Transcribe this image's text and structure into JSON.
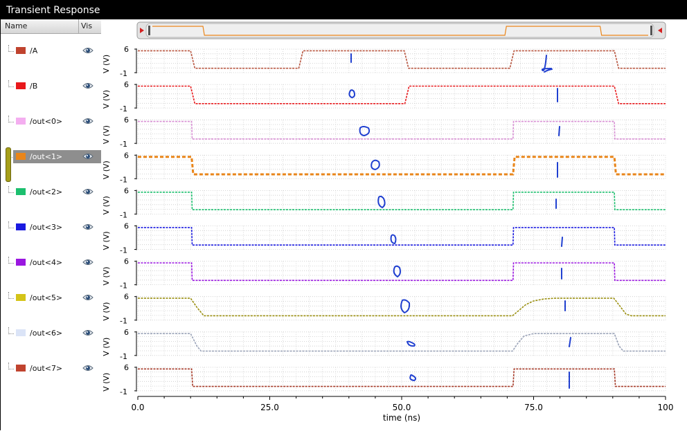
{
  "window": {
    "title": "Transient Response"
  },
  "columns": {
    "name": "Name",
    "vis": "Vis"
  },
  "signals": [
    {
      "label": "/A",
      "color": "#c0432e",
      "selected": false
    },
    {
      "label": "/B",
      "color": "#e8181b",
      "selected": false
    },
    {
      "label": "/out<0>",
      "color": "#f4aef0",
      "selected": false
    },
    {
      "label": "/out<1>",
      "color": "#e98519",
      "selected": true
    },
    {
      "label": "/out<2>",
      "color": "#1cbf6e",
      "selected": false
    },
    {
      "label": "/out<3>",
      "color": "#1a1ae0",
      "selected": false
    },
    {
      "label": "/out<4>",
      "color": "#9a17e0",
      "selected": false
    },
    {
      "label": "/out<5>",
      "color": "#d4c418",
      "selected": false
    },
    {
      "label": "/out<6>",
      "color": "#dbe4f7",
      "selected": false
    },
    {
      "label": "/out<7>",
      "color": "#c0432e",
      "selected": false
    }
  ],
  "chart_data": {
    "type": "line",
    "xlabel": "time (ns)",
    "x_ticks": [
      "0.0",
      "25.0",
      "50.0",
      "75.0",
      "100"
    ],
    "x_range": [
      0,
      100
    ],
    "y_label_each": "V (V)",
    "y_ticks": [
      "6",
      "-1"
    ],
    "y_range": [
      -1,
      6
    ],
    "grid": true,
    "series": [
      {
        "name": "/A",
        "color": "#b8553f",
        "points": [
          [
            0,
            5.5
          ],
          [
            10,
            5.5
          ],
          [
            10.8,
            0.3
          ],
          [
            30.5,
            0.3
          ],
          [
            31.3,
            5.5
          ],
          [
            50.5,
            5.5
          ],
          [
            51.3,
            0.3
          ],
          [
            70.5,
            0.3
          ],
          [
            71.3,
            5.5
          ],
          [
            90.3,
            5.5
          ],
          [
            91.1,
            0.3
          ],
          [
            100,
            0.3
          ]
        ]
      },
      {
        "name": "/B",
        "color": "#e8181b",
        "points": [
          [
            0,
            5.5
          ],
          [
            10,
            5.5
          ],
          [
            10.8,
            0.3
          ],
          [
            50.6,
            0.3
          ],
          [
            51.4,
            5.5
          ],
          [
            90.3,
            5.5
          ],
          [
            91.1,
            0.3
          ],
          [
            100,
            0.3
          ]
        ]
      },
      {
        "name": "/out<0>",
        "color": "#d88fd4",
        "points": [
          [
            0,
            5.5
          ],
          [
            10.2,
            5.5
          ],
          [
            10.3,
            0.3
          ],
          [
            71.1,
            0.3
          ],
          [
            71.2,
            5.5
          ],
          [
            90.3,
            5.5
          ],
          [
            90.4,
            0.3
          ],
          [
            100,
            0.3
          ]
        ]
      },
      {
        "name": "/out<1>",
        "color": "#e98519",
        "points": [
          [
            0,
            5.5
          ],
          [
            10.2,
            5.5
          ],
          [
            10.5,
            0.3
          ],
          [
            71.1,
            0.3
          ],
          [
            71.4,
            5.5
          ],
          [
            90.3,
            5.5
          ],
          [
            90.6,
            0.3
          ],
          [
            100,
            0.3
          ]
        ]
      },
      {
        "name": "/out<2>",
        "color": "#1cbf6e",
        "points": [
          [
            0,
            5.5
          ],
          [
            10.2,
            5.5
          ],
          [
            10.3,
            0.3
          ],
          [
            71.1,
            0.3
          ],
          [
            71.2,
            5.5
          ],
          [
            90.3,
            5.5
          ],
          [
            90.4,
            0.3
          ],
          [
            100,
            0.3
          ]
        ]
      },
      {
        "name": "/out<3>",
        "color": "#1a1ae0",
        "points": [
          [
            0,
            5.5
          ],
          [
            10.2,
            5.5
          ],
          [
            10.3,
            0.3
          ],
          [
            71.1,
            0.3
          ],
          [
            71.2,
            5.5
          ],
          [
            90.3,
            5.5
          ],
          [
            90.4,
            0.3
          ],
          [
            100,
            0.3
          ]
        ]
      },
      {
        "name": "/out<4>",
        "color": "#9a17e0",
        "points": [
          [
            0,
            5.5
          ],
          [
            10.2,
            5.5
          ],
          [
            10.3,
            0.3
          ],
          [
            71.1,
            0.3
          ],
          [
            71.2,
            5.5
          ],
          [
            90.3,
            5.5
          ],
          [
            90.4,
            0.3
          ],
          [
            100,
            0.3
          ]
        ]
      },
      {
        "name": "/out<5>",
        "color": "#9a8f10",
        "points": [
          [
            0,
            5.5
          ],
          [
            10,
            5.5
          ],
          [
            11.2,
            2.8
          ],
          [
            12.5,
            0.3
          ],
          [
            71,
            0.3
          ],
          [
            72,
            1.6
          ],
          [
            73.5,
            3.6
          ],
          [
            75,
            4.7
          ],
          [
            77,
            5.3
          ],
          [
            79,
            5.5
          ],
          [
            90.2,
            5.5
          ],
          [
            91.2,
            3.5
          ],
          [
            92.5,
            0.8
          ],
          [
            93.5,
            0.3
          ],
          [
            100,
            0.3
          ]
        ]
      },
      {
        "name": "/out<6>",
        "color": "#9aa3b8",
        "points": [
          [
            0,
            5.5
          ],
          [
            10,
            5.5
          ],
          [
            11.2,
            1.8
          ],
          [
            12,
            0.3
          ],
          [
            71,
            0.3
          ],
          [
            72,
            2.6
          ],
          [
            73.2,
            4.8
          ],
          [
            75,
            5.5
          ],
          [
            90.3,
            5.5
          ],
          [
            91.2,
            1.8
          ],
          [
            92,
            0.3
          ],
          [
            100,
            0.3
          ]
        ]
      },
      {
        "name": "/out<7>",
        "color": "#a63a28",
        "points": [
          [
            0,
            5.5
          ],
          [
            10.2,
            5.5
          ],
          [
            10.4,
            0.3
          ],
          [
            71.1,
            0.3
          ],
          [
            71.3,
            5.5
          ],
          [
            90.3,
            5.5
          ],
          [
            90.5,
            0.3
          ],
          [
            100,
            0.3
          ]
        ]
      }
    ]
  },
  "overview": {
    "color": "#e98519",
    "points": [
      [
        0,
        5.5
      ],
      [
        10.2,
        5.5
      ],
      [
        10.5,
        0.3
      ],
      [
        71.1,
        0.3
      ],
      [
        71.4,
        5.5
      ],
      [
        90.3,
        5.5
      ],
      [
        90.6,
        0.3
      ],
      [
        100,
        0.3
      ]
    ]
  }
}
